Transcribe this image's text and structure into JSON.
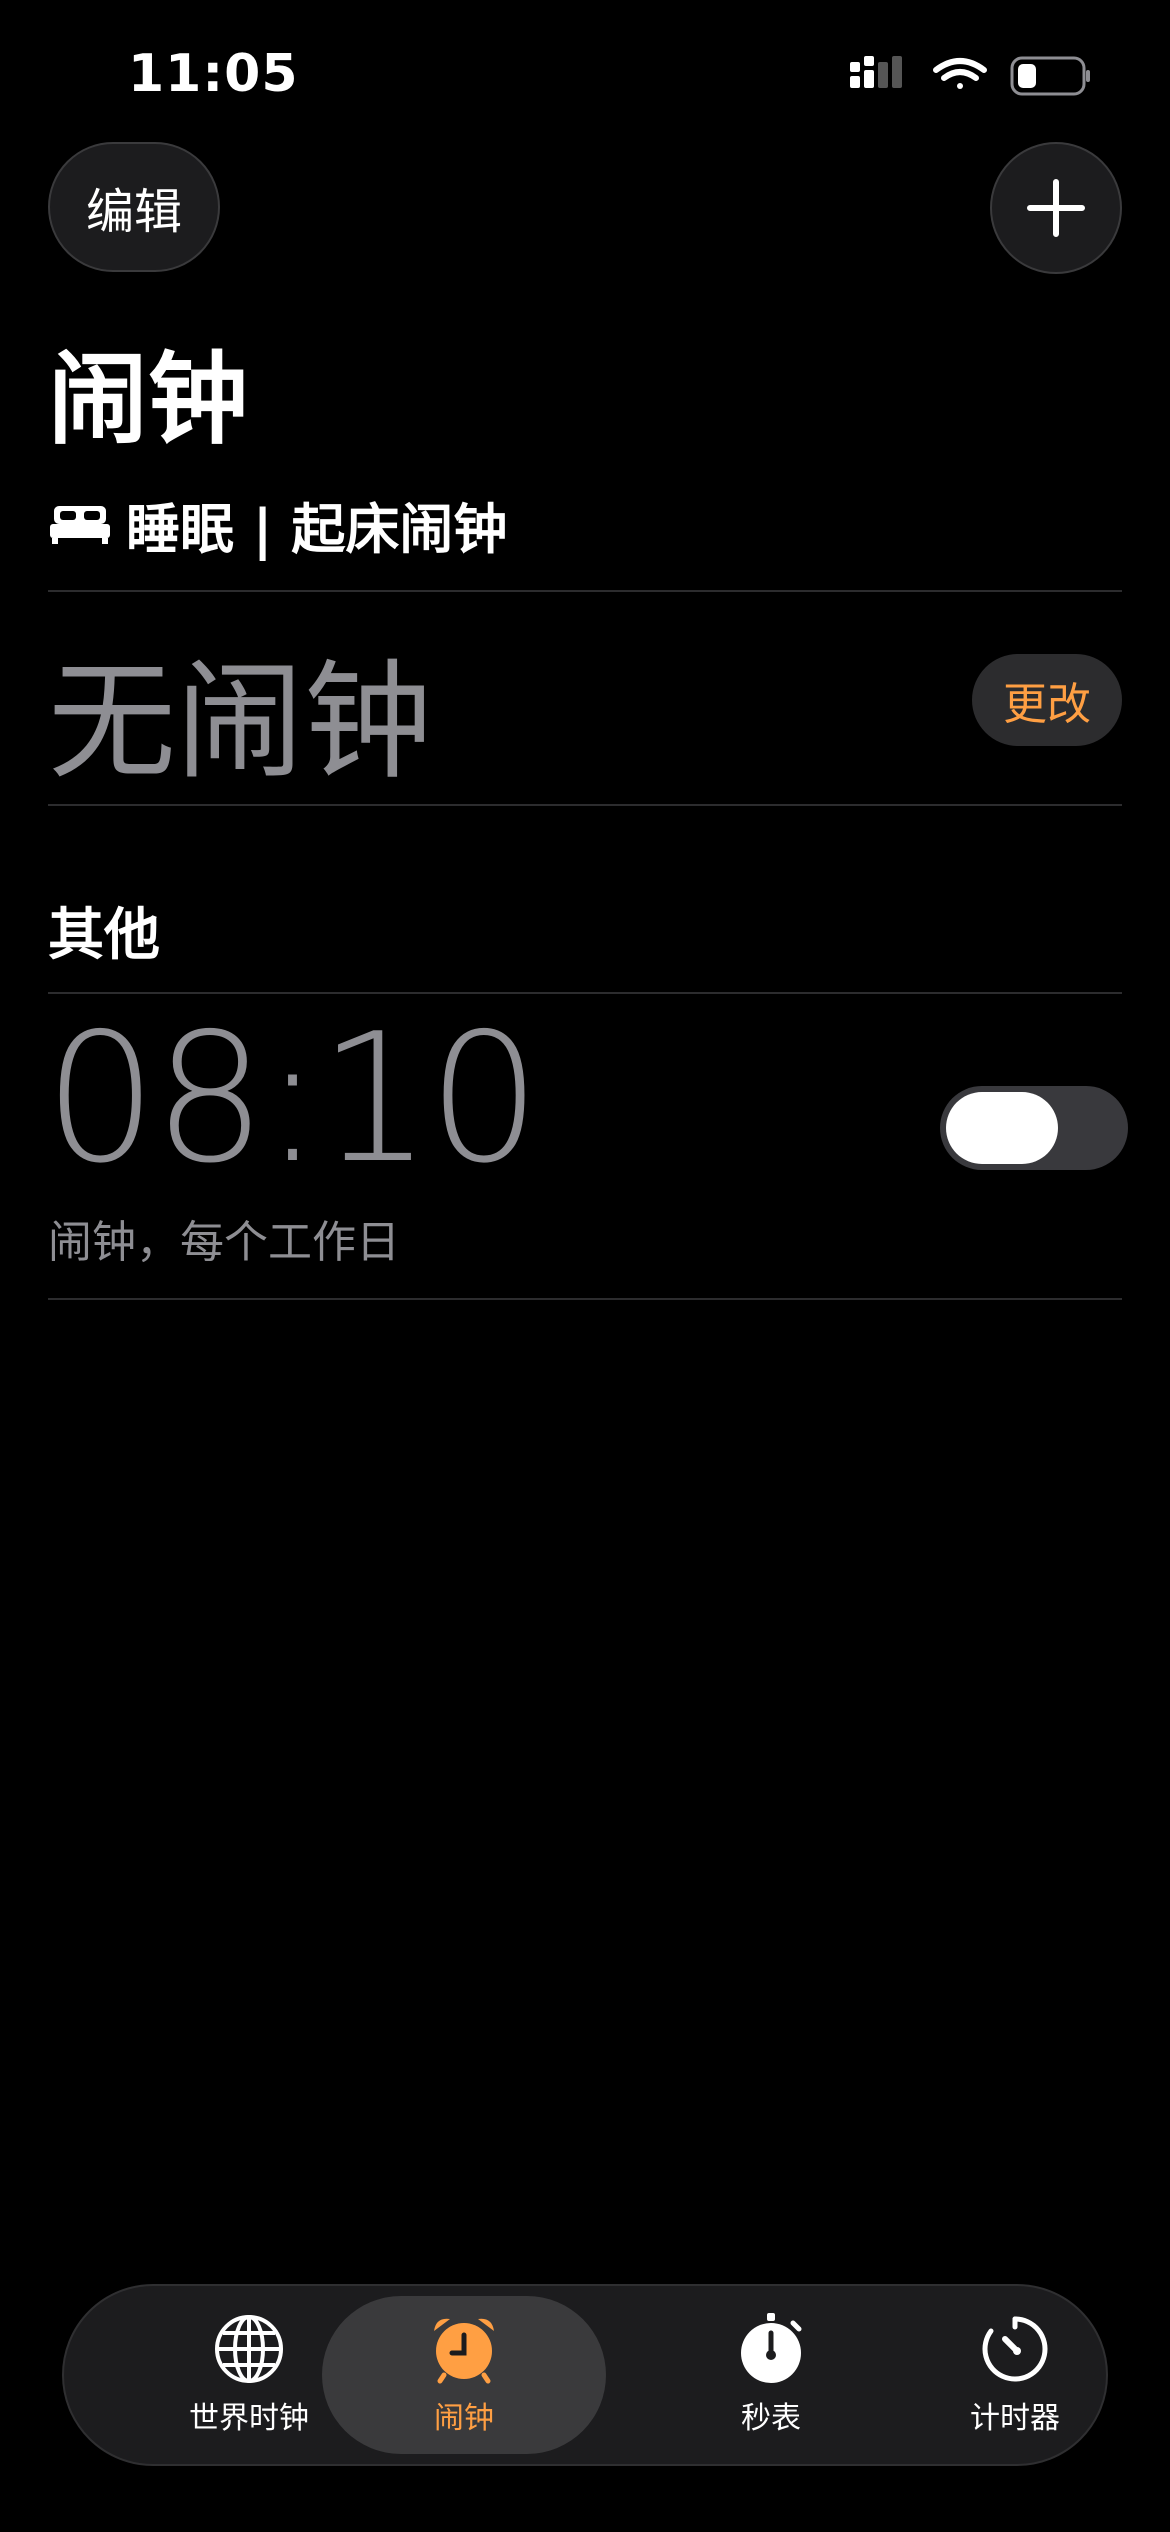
{
  "status_bar": {
    "time": "11:05"
  },
  "toolbar": {
    "edit_label": "编辑"
  },
  "page": {
    "title": "闹钟"
  },
  "sleep": {
    "header": "睡眠 | 起床闹钟",
    "no_alarm": "无闹钟",
    "change_label": "更改"
  },
  "other": {
    "header": "其他",
    "alarms": [
      {
        "time": "08:10",
        "label": "闹钟，每个工作日",
        "enabled": false
      }
    ]
  },
  "tabs": [
    {
      "label": "世界时钟",
      "icon": "globe-icon",
      "active": false
    },
    {
      "label": "闹钟",
      "icon": "alarm-clock-icon",
      "active": true
    },
    {
      "label": "秒表",
      "icon": "stopwatch-icon",
      "active": false
    },
    {
      "label": "计时器",
      "icon": "timer-icon",
      "active": false
    }
  ],
  "colors": {
    "accent": "#ff9f43",
    "background": "#000000",
    "secondary_text": "#8e8e93"
  }
}
